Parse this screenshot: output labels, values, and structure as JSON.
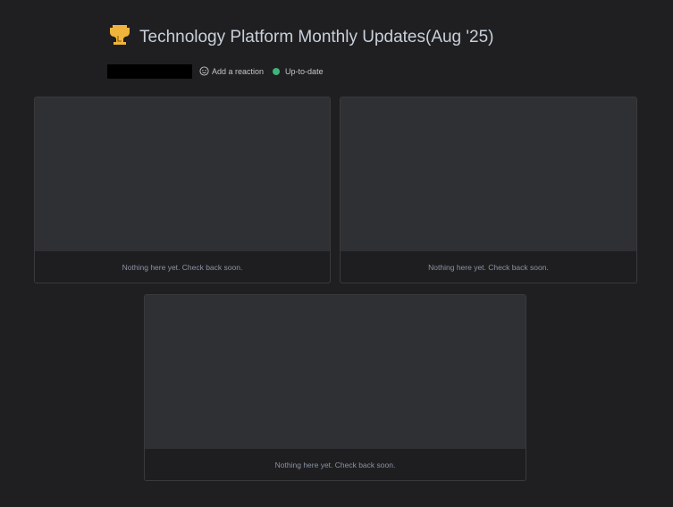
{
  "header": {
    "title": "Technology Platform Monthly Updates(Aug '25)",
    "add_reaction": "Add a reaction",
    "status": "Up-to-date",
    "status_color": "#3fb37a",
    "icon": "trophy-icon"
  },
  "cards": [
    {
      "empty_text": "Nothing here yet. Check back soon."
    },
    {
      "empty_text": "Nothing here yet. Check back soon."
    },
    {
      "empty_text": "Nothing here yet. Check back soon."
    }
  ]
}
